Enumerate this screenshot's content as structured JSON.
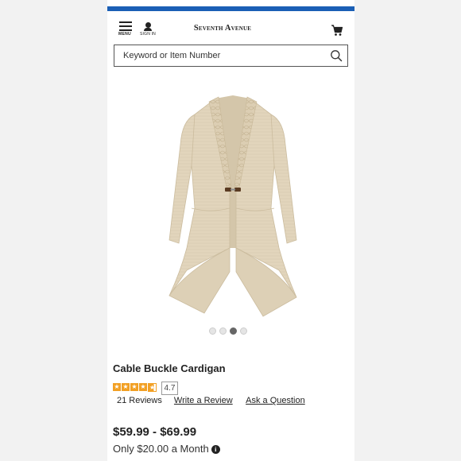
{
  "header": {
    "menu_label": "MENU",
    "signin_label": "SIGN IN",
    "logo_text": "Seventh Avenue",
    "menu_icon": "hamburger-icon",
    "cart_icon": "cart-icon"
  },
  "search": {
    "placeholder": "Keyword or Item Number",
    "icon": "magnifier-icon"
  },
  "gallery": {
    "image_alt": "Cable Buckle Cardigan",
    "total_images": 4,
    "active_index": 3
  },
  "product": {
    "title": "Cable Buckle Cardigan",
    "rating": "4.7",
    "rating_value": 4.7,
    "rating_max": 5,
    "reviews_count": "21 Reviews",
    "write_review": "Write a Review",
    "ask_question": "Ask a Question",
    "price": "$59.99 - $69.99",
    "monthly": "Only $20.00 a Month",
    "info_icon": "info-icon"
  },
  "colors": {
    "accent_bar": "#1b5fb5",
    "star": "#f2a024",
    "garment": "#e2d5bc"
  }
}
